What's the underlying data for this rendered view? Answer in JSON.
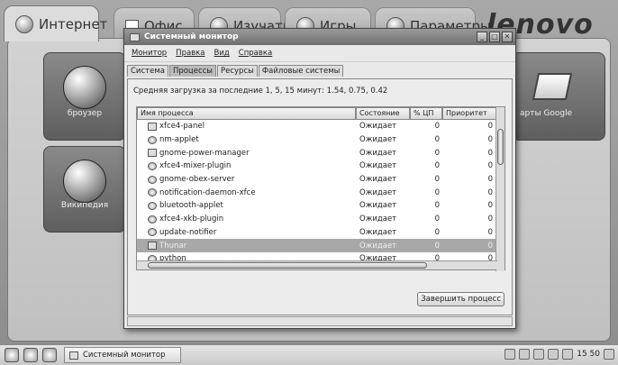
{
  "top_tabs": [
    {
      "label": "Интернет",
      "icon": "globe-icon"
    },
    {
      "label": "Офис",
      "icon": "document-icon"
    },
    {
      "label": "Изучать",
      "icon": "learn-icon"
    },
    {
      "label": "Игры",
      "icon": "games-icon"
    },
    {
      "label": "Параметры",
      "icon": "settings-icon"
    }
  ],
  "brand": "lenovo",
  "tiles": {
    "browser": "броузер",
    "wikipedia": "Википедия",
    "maps": "арты Google"
  },
  "window": {
    "title": "Системный монитор",
    "menu": [
      "Монитор",
      "Правка",
      "Вид",
      "Справка"
    ],
    "tabs": [
      "Система",
      "Процессы",
      "Ресурсы",
      "Файловые системы"
    ],
    "load_avg": "Средняя загрузка за последние 1, 5, 15 минут: 1.54, 0.75, 0.42",
    "columns": [
      "Имя процесса",
      "Состояние",
      "% ЦП",
      "Приоритет"
    ],
    "rows": [
      [
        "xfce4-panel",
        "Ожидает",
        "0",
        "0"
      ],
      [
        "nm-applet",
        "Ожидает",
        "0",
        "0"
      ],
      [
        "gnome-power-manager",
        "Ожидает",
        "0",
        "0"
      ],
      [
        "xfce4-mixer-plugin",
        "Ожидает",
        "0",
        "0"
      ],
      [
        "gnome-obex-server",
        "Ожидает",
        "0",
        "0"
      ],
      [
        "notification-daemon-xfce",
        "Ожидает",
        "0",
        "0"
      ],
      [
        "bluetooth-applet",
        "Ожидает",
        "0",
        "0"
      ],
      [
        "xfce4-xkb-plugin",
        "Ожидает",
        "0",
        "0"
      ],
      [
        "update-notifier",
        "Ожидает",
        "0",
        "0"
      ],
      [
        "Thunar",
        "Ожидает",
        "0",
        "0"
      ],
      [
        "python",
        "Ожидает",
        "0",
        "0"
      ]
    ],
    "kill_button": "Завершить процесс"
  },
  "taskbar": {
    "task": "Системный монитор",
    "clock": "15 50"
  }
}
